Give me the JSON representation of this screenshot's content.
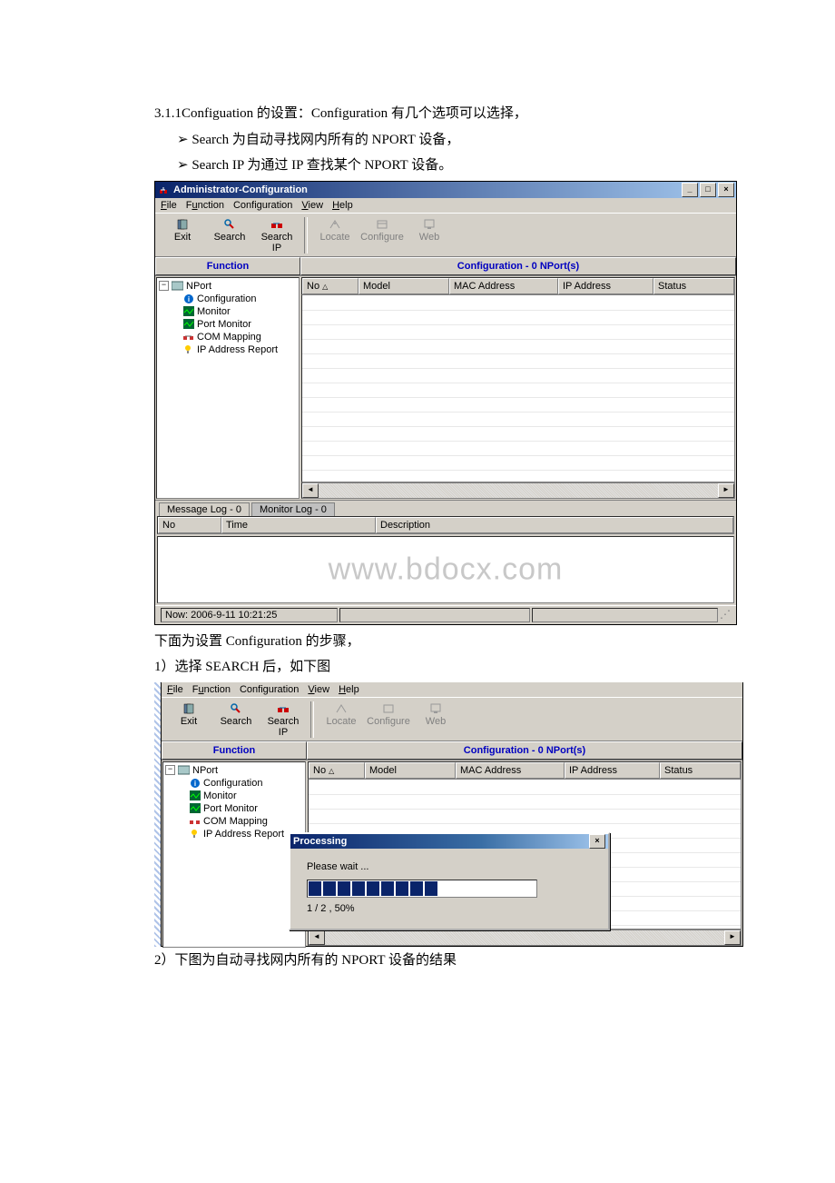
{
  "doc": {
    "p1": "3.1.1Configuation 的设置：Configuration 有几个选项可以选择，",
    "b1": "Search 为自动寻找网内所有的 NPORT 设备，",
    "b2": "Search IP 为通过 IP 查找某个 NPORT 设备。",
    "p2": "下面为设置 Configuration 的步骤，",
    "p3": "1）选择 SEARCH 后，如下图",
    "p4": "2）下图为自动寻找网内所有的 NPORT 设备的结果"
  },
  "window_title": "Administrator-Configuration",
  "menu": {
    "file": "File",
    "function": "Function",
    "config": "Configuration",
    "view": "View",
    "help": "Help"
  },
  "toolbar": {
    "exit": "Exit",
    "search": "Search",
    "searchip": "Search IP",
    "locate": "Locate",
    "configure": "Configure",
    "web": "Web"
  },
  "panes": {
    "function": "Function",
    "config": "Configuration - 0 NPort(s)"
  },
  "tree": {
    "root": "NPort",
    "c1": "Configuration",
    "c2": "Monitor",
    "c3": "Port Monitor",
    "c4": "COM Mapping",
    "c5": "IP Address Report"
  },
  "cols": {
    "no": "No",
    "model": "Model",
    "mac": "MAC Address",
    "ip": "IP Address",
    "status": "Status"
  },
  "tabs": {
    "msg": "Message Log - 0",
    "mon": "Monitor Log - 0"
  },
  "logcols": {
    "no": "No",
    "time": "Time",
    "desc": "Description"
  },
  "status": "Now: 2006-9-11 10:21:25",
  "watermark": "www.bdocx.com",
  "dialog": {
    "title": "Processing",
    "wait": "Please wait ...",
    "progress": "1 / 2 , 50%"
  }
}
